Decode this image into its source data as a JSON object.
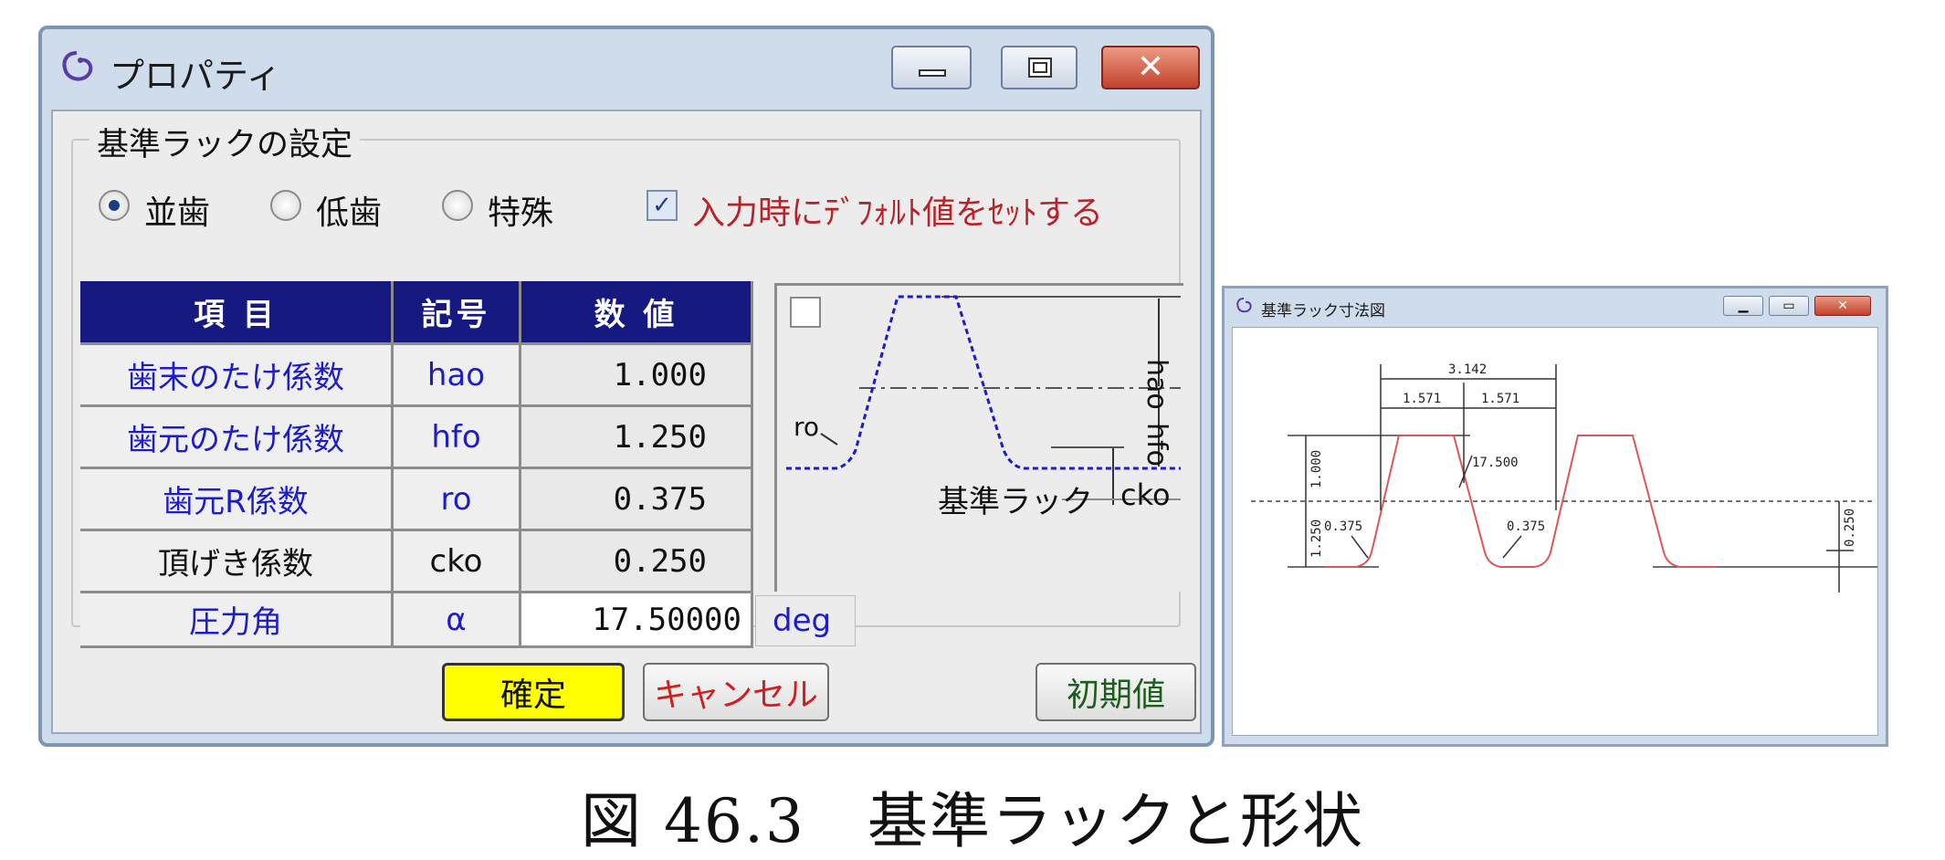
{
  "main_window": {
    "title": "プロパティ",
    "close_glyph": "✕",
    "group_title": "基準ラックの設定",
    "options": {
      "standard": "並歯",
      "stub": "低歯",
      "special": "特殊",
      "default_check_label": "入力時にﾃﾞﾌｫﾙﾄ値をｾｯﾄする",
      "check_mark": "✓"
    },
    "table": {
      "headers": [
        "項 目",
        "記号",
        "数 値"
      ],
      "rows": [
        {
          "name": "歯末のたけ係数",
          "symbol": "hao",
          "value": "1.000"
        },
        {
          "name": "歯元のたけ係数",
          "symbol": "hfo",
          "value": "1.250"
        },
        {
          "name": "歯元R係数",
          "symbol": "ro",
          "value": "0.375"
        },
        {
          "name": "頂げき係数",
          "symbol": "cko",
          "value": "0.250"
        },
        {
          "name": "圧力角",
          "symbol": "α",
          "value": "17.50000",
          "unit": "deg"
        }
      ]
    },
    "preview": {
      "label_hao": "hao",
      "label_hfo": "hfo",
      "label_ro": "ro",
      "label_cko": "cko",
      "label_rack": "基準ラック"
    },
    "buttons": {
      "ok": "確定",
      "cancel": "キャンセル",
      "reset": "初期値"
    }
  },
  "dimension_window": {
    "title": "基準ラック寸法図",
    "close_glyph": "✕",
    "dims": {
      "pitch": "3.142",
      "half_left": "1.571",
      "half_right": "1.571",
      "angle": "17.500",
      "addendum": "1.000",
      "dedendum": "1.250",
      "root_r_left": "0.375",
      "root_r_mid": "0.375",
      "clearance": "0.250"
    }
  },
  "caption": "図 46.3　基準ラックと形状"
}
